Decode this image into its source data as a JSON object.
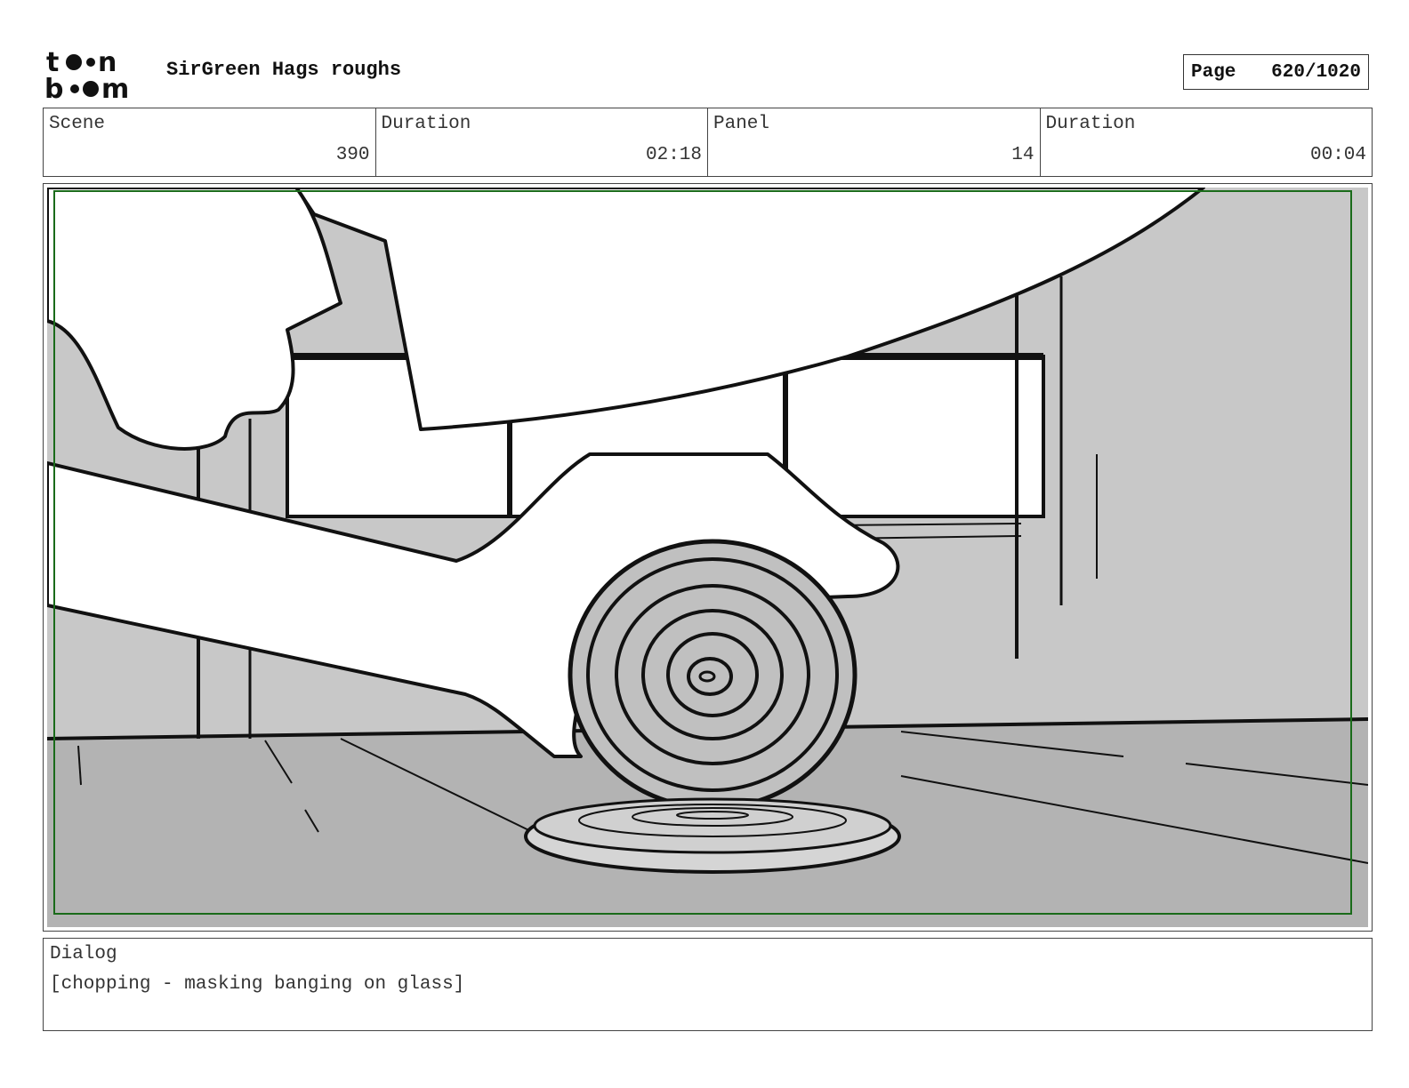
{
  "header": {
    "logo_line1": "toon",
    "logo_line2": "boom",
    "project_title": "SirGreen Hags roughs",
    "page_label": "Page",
    "page_value": "620/1020"
  },
  "info": {
    "scene_label": "Scene",
    "scene_value": "390",
    "scene_duration_label": "Duration",
    "scene_duration_value": "02:18",
    "panel_label": "Panel",
    "panel_value": "14",
    "panel_duration_label": "Duration",
    "panel_duration_value": "00:04"
  },
  "panel": {
    "description": "",
    "safe_frame_color": "#1a6b1a",
    "background_gray": "#c8c8c8",
    "floor_gray": "#b3b3b3"
  },
  "dialog": {
    "label": "Dialog",
    "text": "[chopping - masking banging on glass]"
  }
}
